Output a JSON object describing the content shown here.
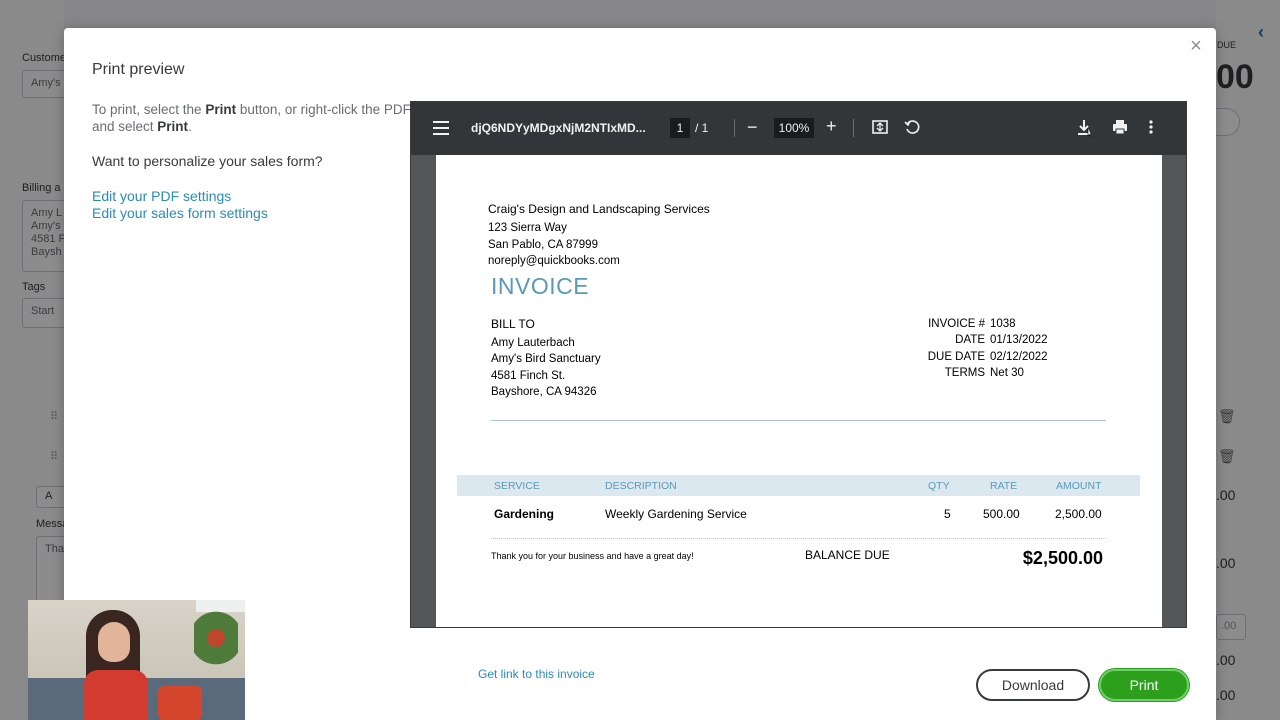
{
  "background": {
    "customer_label": "Custome",
    "customer_value": "Amy's",
    "billing_label": "Billing a",
    "billing_lines": [
      "Amy L",
      "Amy's",
      "4581 F",
      "Baysh"
    ],
    "tags_label": "Tags",
    "tags_placeholder": "Start",
    "message_label": "Messa",
    "message_value": "Tha",
    "balance_label": "DUE",
    "balance_amount": "00",
    "right_btn": "t",
    "amounts": [
      ".00",
      ".00",
      ".00",
      ".00",
      ".00"
    ],
    "add_btn": "A"
  },
  "modal": {
    "title": "Print preview",
    "instructions_1": "To print, select the ",
    "instructions_b1": "Print",
    "instructions_2": " button, or right-click the PDF and select ",
    "instructions_b2": "Print",
    "instructions_3": ".",
    "personalize": "Want to personalize your sales form?",
    "edit_pdf_link": "Edit your PDF settings",
    "edit_form_link": "Edit your sales form settings",
    "get_link": "Get link to this invoice",
    "download_label": "Download",
    "print_label": "Print",
    "close_glyph": "×"
  },
  "viewer": {
    "doc_name": "djQ6NDYyMDgxNjM2NTIxMD...",
    "page_current": "1",
    "page_total": "/ 1",
    "zoom": "100%",
    "minus": "−",
    "plus": "+"
  },
  "invoice": {
    "company_name": "Craig's Design and Landscaping Services",
    "company_lines": [
      "123 Sierra Way",
      "San Pablo, CA  87999",
      "noreply@quickbooks.com"
    ],
    "title": "INVOICE",
    "bill_to_label": "BILL TO",
    "bill_to_lines": [
      "Amy Lauterbach",
      "Amy's Bird Sanctuary",
      "4581 Finch St.",
      "Bayshore, CA  94326"
    ],
    "meta": [
      {
        "label": "INVOICE #",
        "value": "1038"
      },
      {
        "label": "DATE",
        "value": "01/13/2022"
      },
      {
        "label": "DUE DATE",
        "value": "02/12/2022"
      },
      {
        "label": "TERMS",
        "value": "Net 30"
      }
    ],
    "columns": {
      "service": "SERVICE",
      "description": "DESCRIPTION",
      "qty": "QTY",
      "rate": "RATE",
      "amount": "AMOUNT"
    },
    "row": {
      "service": "Gardening",
      "description": "Weekly Gardening Service",
      "qty": "5",
      "rate": "500.00",
      "amount": "2,500.00"
    },
    "thanks": "Thank you for your business and have a great day!",
    "balance_due_label": "BALANCE DUE",
    "balance_due_amount": "$2,500.00"
  }
}
